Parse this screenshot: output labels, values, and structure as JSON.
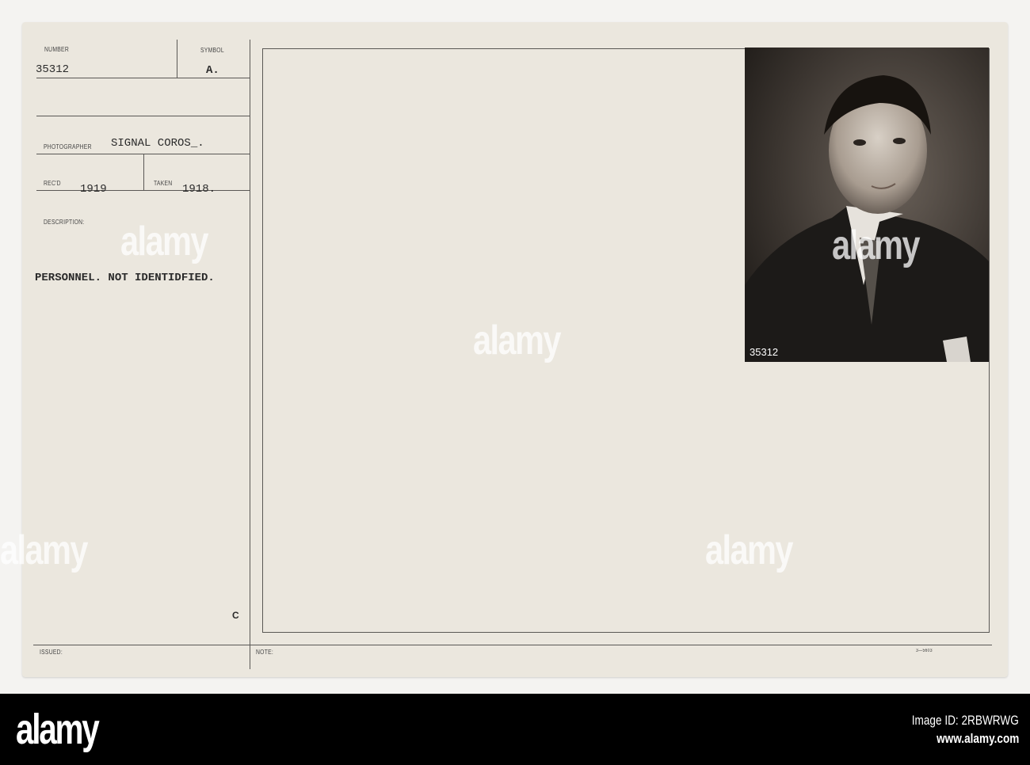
{
  "card": {
    "number_label": "NUMBER",
    "number_value": "35312",
    "symbol_label": "SYMBOL",
    "symbol_value": "A.",
    "photographer_label": "PHOTOGRAPHER",
    "photographer_value": "SIGNAL COROS_.",
    "recd_label": "REC'D",
    "recd_value": "1919",
    "taken_label": "TAKEN",
    "taken_value": "1918.",
    "description_label": "DESCRIPTION:",
    "description_value": "PERSONNEL. NOT IDENTIDFIED.",
    "corner_mark": "C",
    "issued_label": "ISSUED:",
    "note_label": "NOTE:",
    "form_number": "3—5603"
  },
  "photo": {
    "negative_number": "35312"
  },
  "watermark": {
    "logo": "alamy",
    "small": "a"
  },
  "footer": {
    "logo": "alamy",
    "image_id": "Image ID: 2RBWRWG",
    "url": "www.alamy.com"
  }
}
